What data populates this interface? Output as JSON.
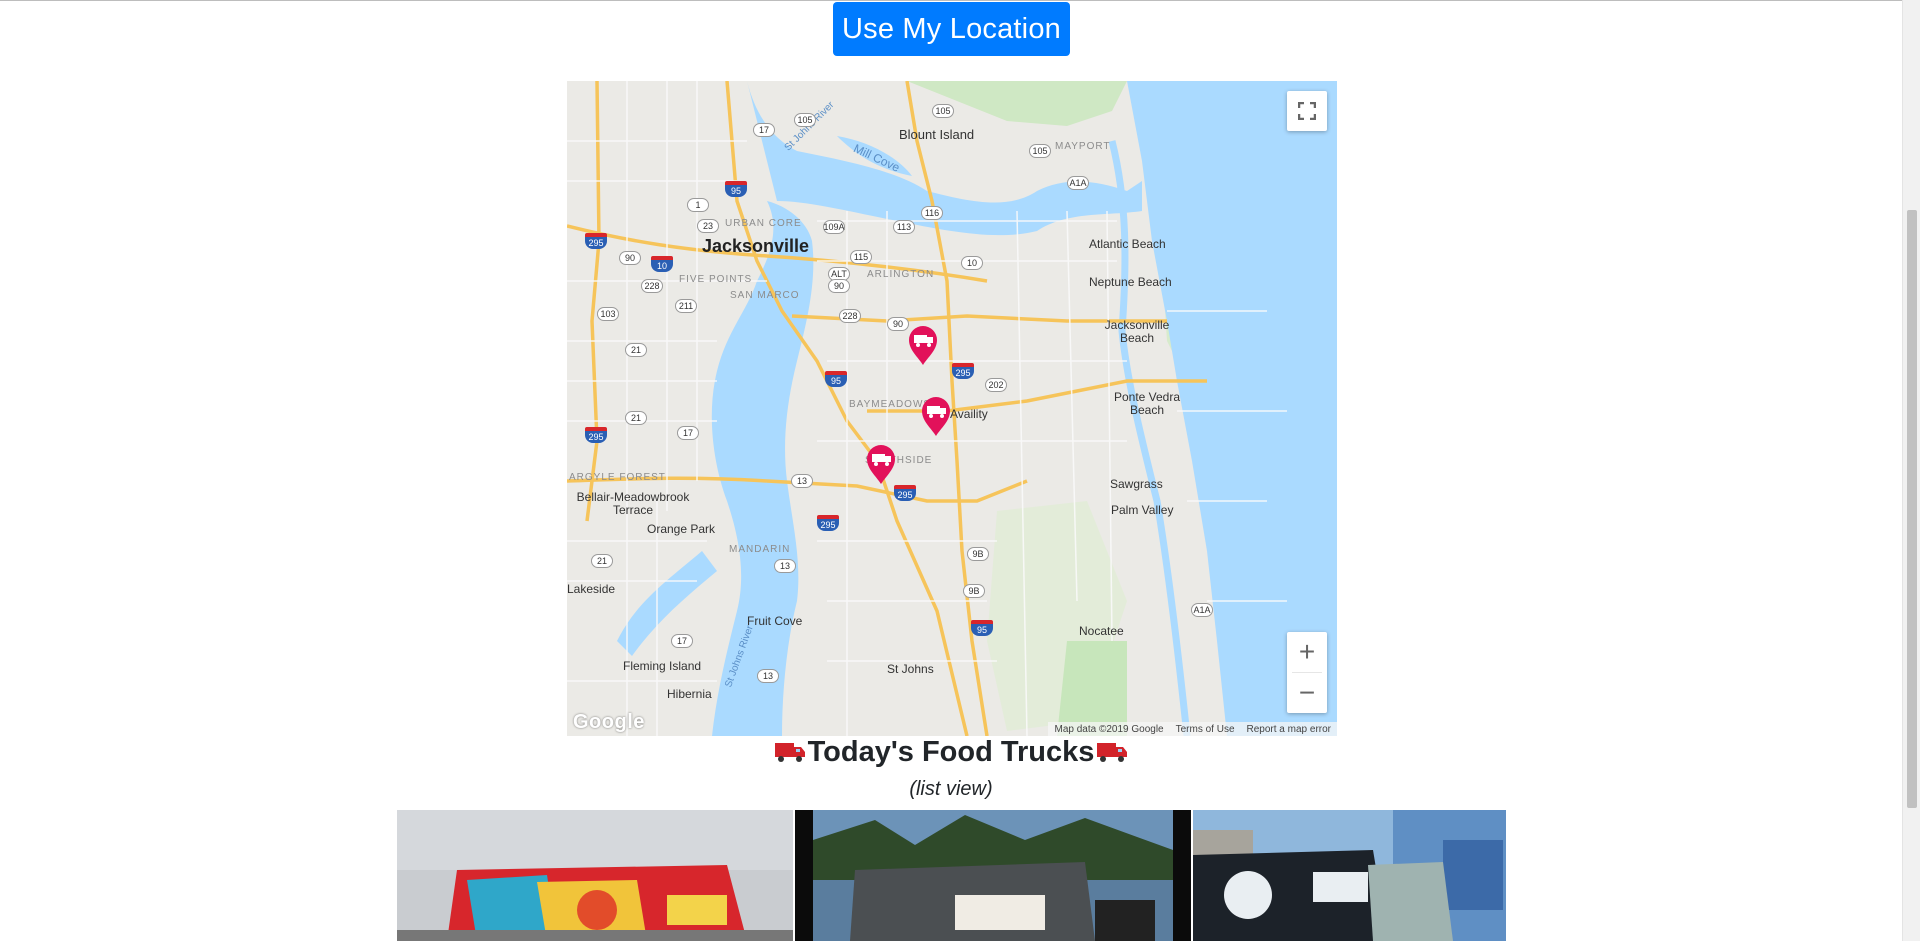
{
  "location_button": {
    "label": "Use My Location"
  },
  "map": {
    "labels": {
      "jacksonville": "Jacksonville",
      "blount_island": "Blount Island",
      "mill_cove": "Mill Cove",
      "st_johns_river_n": "St Johns River",
      "mayport": "MAYPORT",
      "urban_core": "URBAN CORE",
      "five_points": "FIVE POINTS",
      "san_marco": "SAN MARCO",
      "arlington": "ARLINGTON",
      "atlantic_beach": "Atlantic Beach",
      "neptune_beach": "Neptune Beach",
      "jacksonville_beach": "Jacksonville Beach",
      "baymeadows": "BAYMEADOWS",
      "availity": "Availity",
      "ponte_vedra_beach": "Ponte Vedra Beach",
      "southside": "SOUTHSIDE",
      "argyle_forest": "ARGYLE FOREST",
      "bellair": "Bellair-Meadowbrook Terrace",
      "sawgrass": "Sawgrass",
      "palm_valley": "Palm Valley",
      "orange_park": "Orange Park",
      "mandarin": "MANDARIN",
      "lakeside": "Lakeside",
      "fruit_cove": "Fruit Cove",
      "nocatee": "Nocatee",
      "fleming_island": "Fleming Island",
      "st_johns": "St Johns",
      "hibernia": "Hibernia",
      "st_johns_river_s": "St Johns River"
    },
    "routes": [
      "105",
      "17",
      "95",
      "105",
      "1",
      "23",
      "109A",
      "113",
      "116",
      "295",
      "90",
      "10",
      "228",
      "211",
      "ALT",
      "90",
      "115",
      "10",
      "103",
      "21",
      "228",
      "90",
      "295",
      "202",
      "21",
      "17",
      "95",
      "295",
      "295",
      "13",
      "295",
      "13",
      "9B",
      "9B",
      "21",
      "A1A",
      "95",
      "17",
      "13",
      "A1A",
      "105"
    ],
    "attribution": {
      "data": "Map data ©2019 Google",
      "terms": "Terms of Use",
      "report": "Report a map error"
    },
    "logo": "Google",
    "zoom_in": "+",
    "zoom_out": "−",
    "markers": [
      "truck-marker-1",
      "truck-marker-2",
      "truck-marker-3"
    ]
  },
  "section": {
    "title": "Today's Food Trucks",
    "subtitle": "(list view)"
  },
  "colors": {
    "primary": "#007bff",
    "marker": "#e2115a",
    "water": "#a9dcfb"
  }
}
